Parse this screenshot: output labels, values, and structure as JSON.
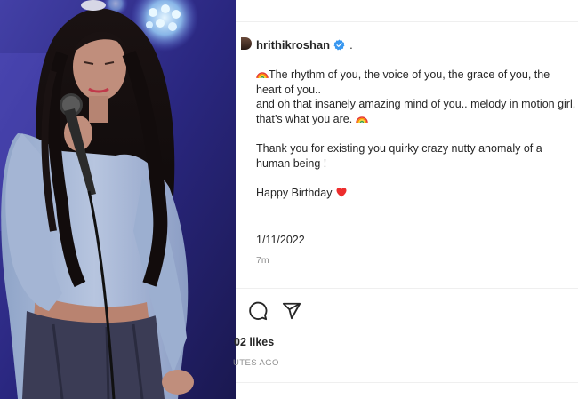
{
  "post": {
    "username": "hrithikroshan",
    "separator": ".",
    "caption_lines": [
      "The rhythm of you, the voice of you, the grace of you, the heart of you..",
      "and oh that insanely amazing mind of you.. melody in motion girl,",
      "that’s what you are."
    ],
    "caption_para2": "Thank you for existing you quirky crazy nutty anomaly of a human being !",
    "caption_para3": "Happy Birthday",
    "date": "1/11/2022",
    "time_ago": "7m",
    "likes_text": "02 likes",
    "posted_ago": "UTES AGO"
  },
  "colors": {
    "verified": "#3897f0",
    "heart": "#ed2d2d",
    "text": "#262626",
    "muted": "#8e8e8e"
  },
  "icons": {
    "comment": "comment-icon",
    "share": "share-icon",
    "verified": "verified-badge-icon",
    "rainbow": "rainbow-emoji-icon",
    "heart": "heart-emoji-icon"
  }
}
